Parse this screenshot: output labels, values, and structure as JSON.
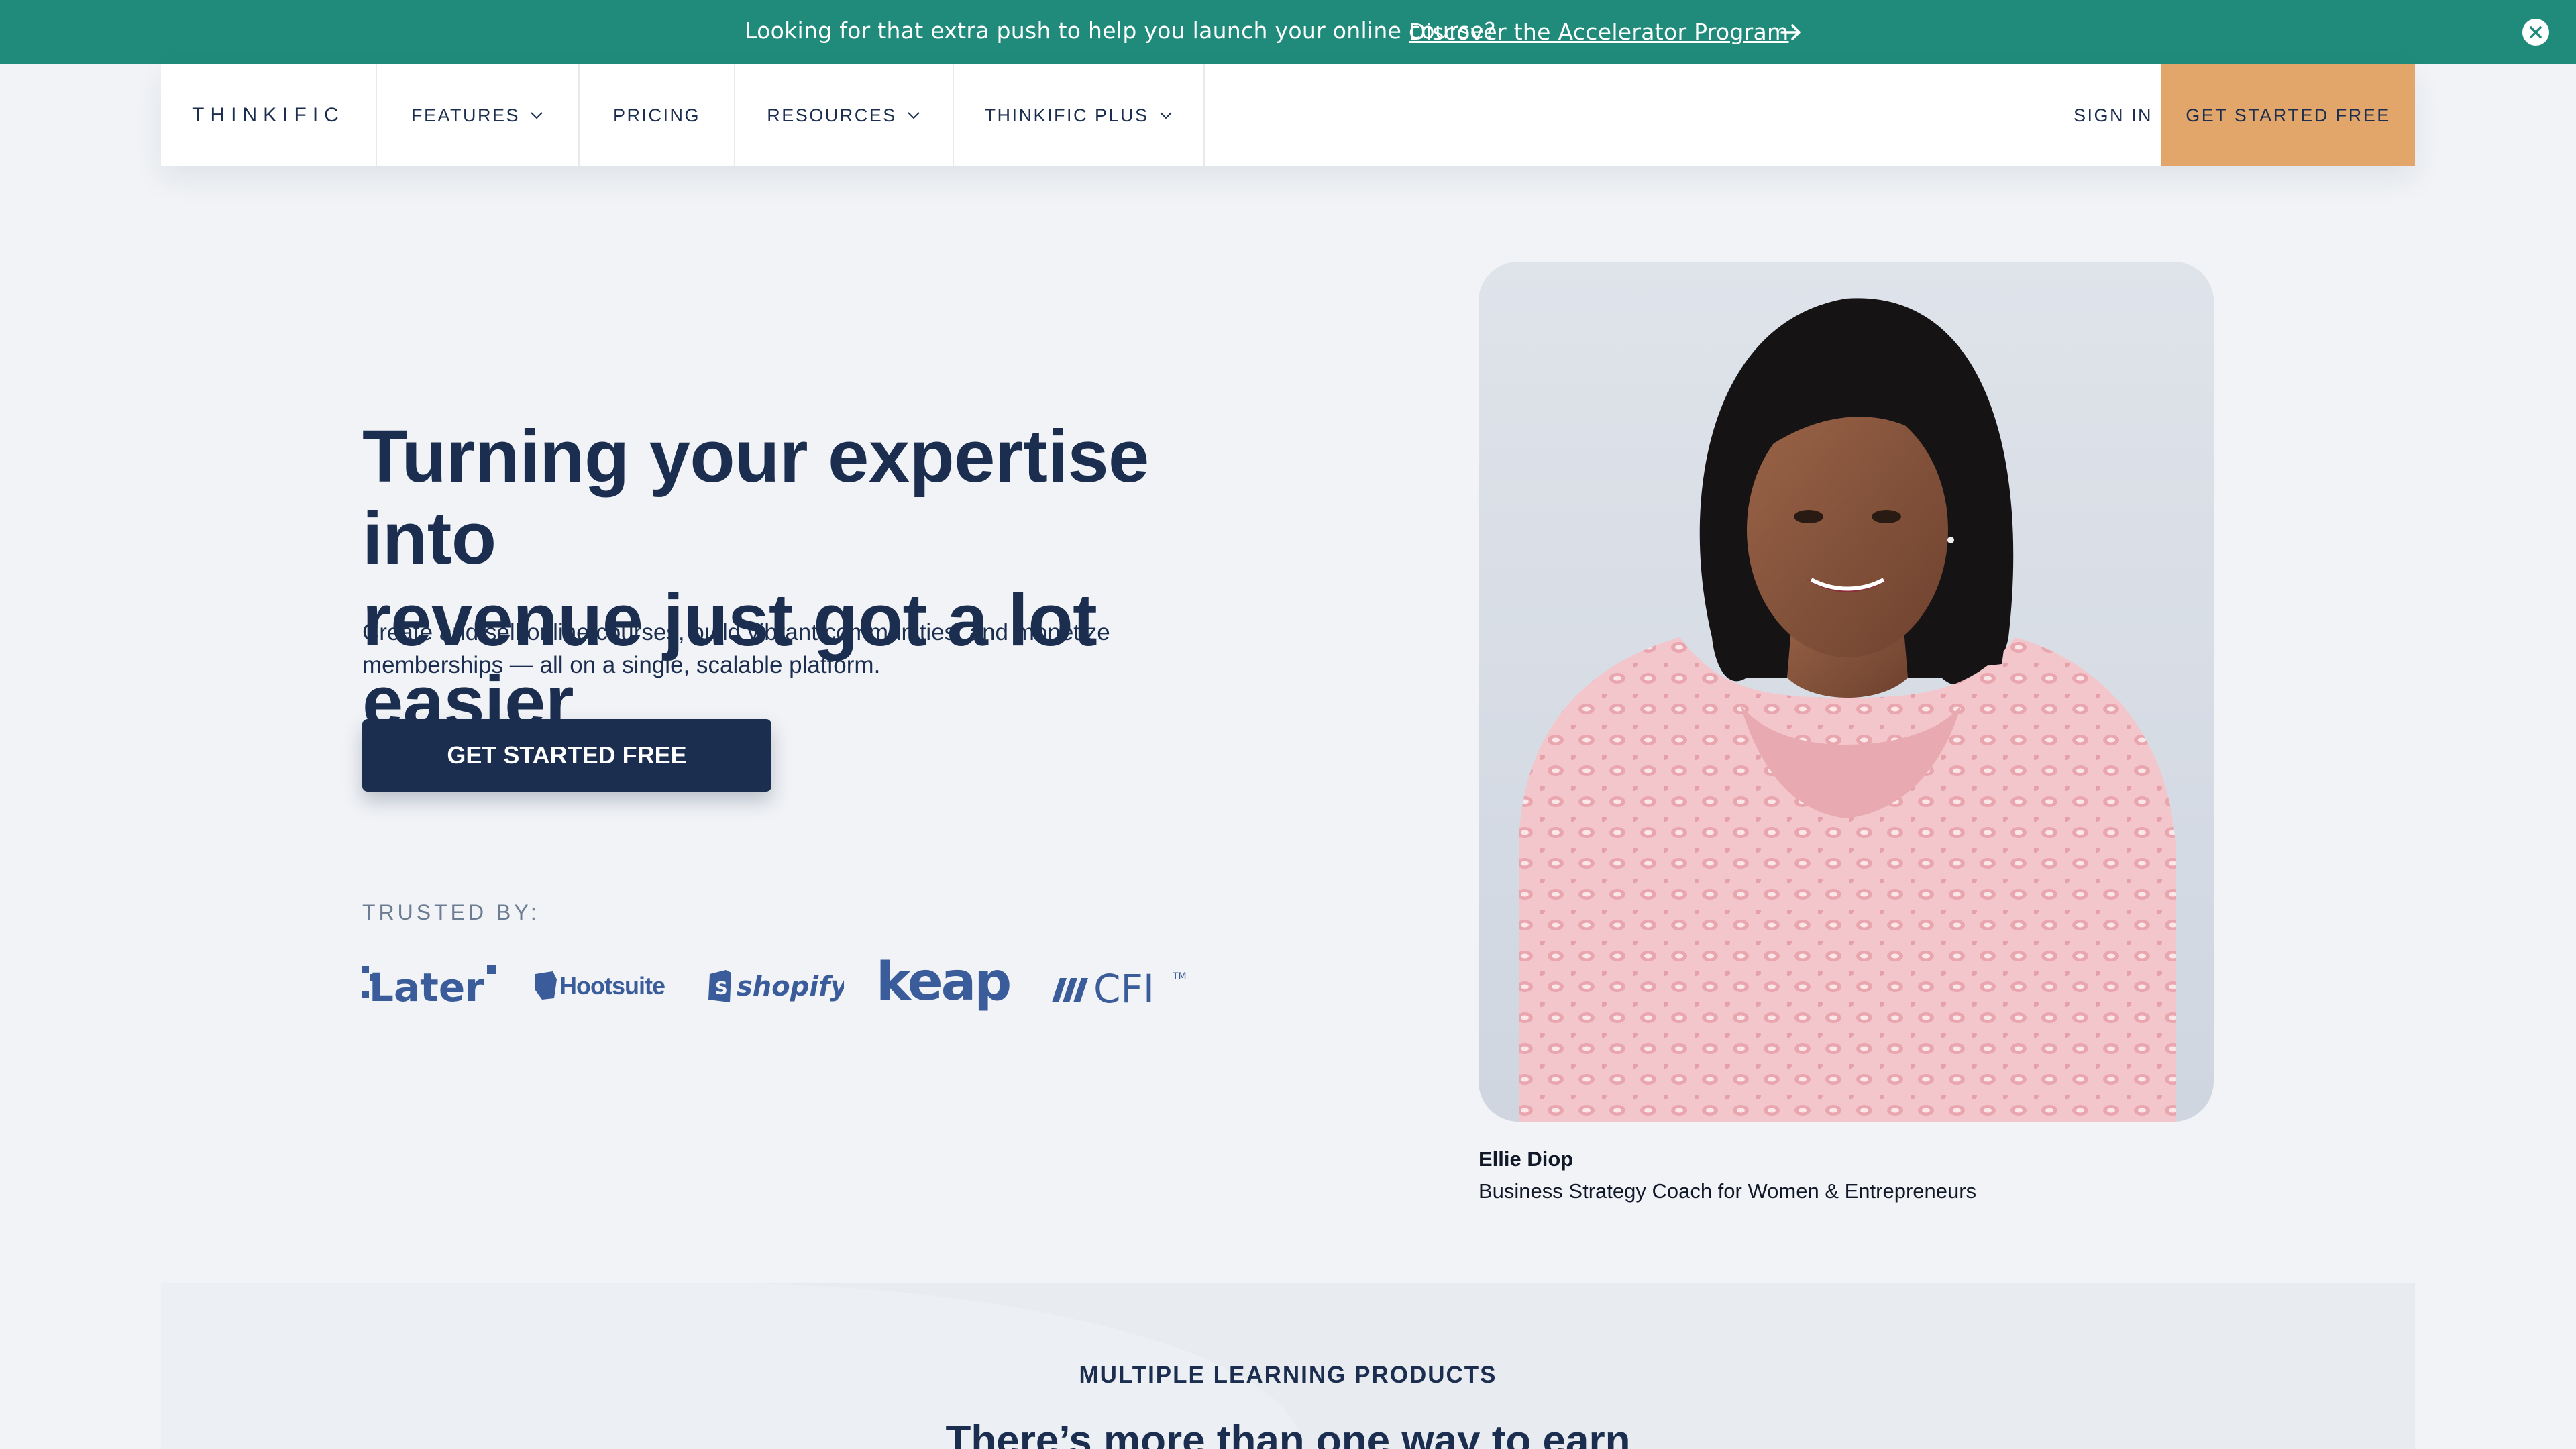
{
  "announcement": {
    "message": "Looking for that extra push to help you launch your online course?",
    "link_text": "Discover the Accelerator Program",
    "arrow_icon": "arrow-right-icon",
    "close_icon": "close-icon",
    "background": "#218b7b"
  },
  "nav": {
    "logo": "THINKIFIC",
    "items": [
      {
        "label": "FEATURES",
        "has_dropdown": true
      },
      {
        "label": "PRICING",
        "has_dropdown": false
      },
      {
        "label": "RESOURCES",
        "has_dropdown": true
      },
      {
        "label": "THINKIFIC PLUS",
        "has_dropdown": true
      }
    ],
    "sign_in": "SIGN IN",
    "cta": "GET STARTED FREE",
    "cta_color": "#e2a66b"
  },
  "hero": {
    "title_line1": "Turning your expertise into",
    "title_line2": "revenue just got a lot easier",
    "subtitle_line1": "Create and sell online courses, build vibrant communities, and monetize",
    "subtitle_line2": "memberships — all on a single, scalable platform.",
    "button": "GET STARTED FREE",
    "button_color": "#1b2e4f",
    "trusted_label": "TRUSTED BY:",
    "trusted_logos": [
      "Later",
      "Hootsuite",
      "shopify",
      "keap",
      "CFI"
    ]
  },
  "testimonial": {
    "name": "Ellie Diop",
    "role": "Business Strategy Coach for Women & Entrepreneurs"
  },
  "lower": {
    "eyebrow": "MULTIPLE LEARNING PRODUCTS",
    "heading": "There’s more than one way to earn"
  }
}
